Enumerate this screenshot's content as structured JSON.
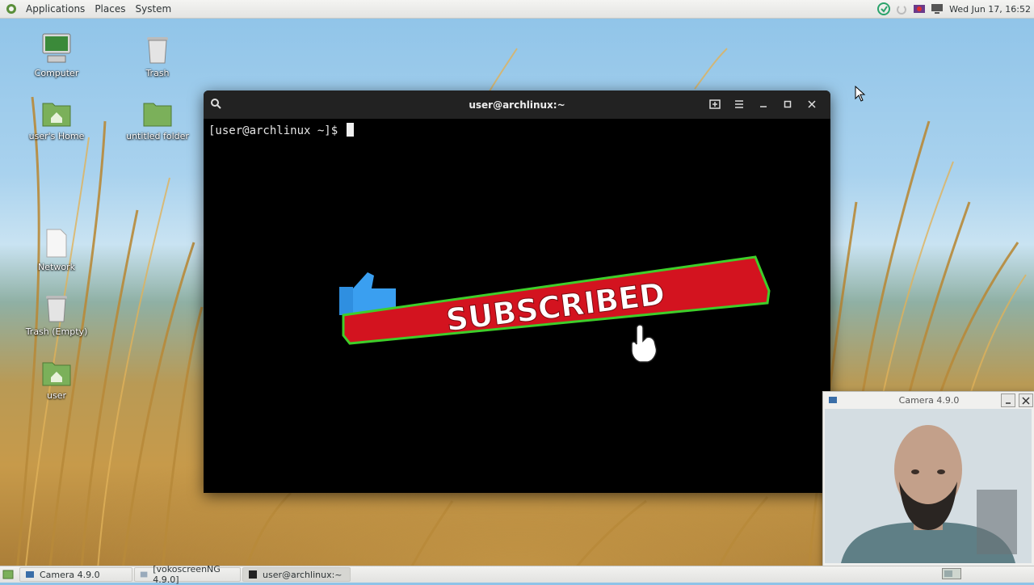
{
  "top_panel": {
    "menus": [
      "Applications",
      "Places",
      "System"
    ],
    "clock": "Wed Jun 17, 16:52"
  },
  "desktop_icons": [
    {
      "label": "Computer",
      "icon": "computer-icon"
    },
    {
      "label": "Trash",
      "icon": "trash-icon"
    },
    {
      "label": "user's Home",
      "icon": "home-folder-icon"
    },
    {
      "label": "untitled folder",
      "icon": "folder-icon"
    },
    {
      "label": "Network",
      "icon": "network-icon"
    },
    {
      "label": "Trash (Empty)",
      "icon": "trash-icon"
    },
    {
      "label": "user",
      "icon": "home-folder-icon"
    }
  ],
  "terminal": {
    "title": "user@archlinux:~",
    "prompt": "[user@archlinux ~]$"
  },
  "overlay": {
    "text": "SUBSCRIBED",
    "colors": {
      "banner": "#d3131f",
      "outline": "#3ecf2a",
      "thumb": "#2f8fe0"
    }
  },
  "camera_window": {
    "title": "Camera 4.9.0"
  },
  "taskbar": {
    "tasks": [
      "Camera 4.9.0",
      "[vokoscreenNG 4.9.0]",
      "user@archlinux:~"
    ]
  }
}
